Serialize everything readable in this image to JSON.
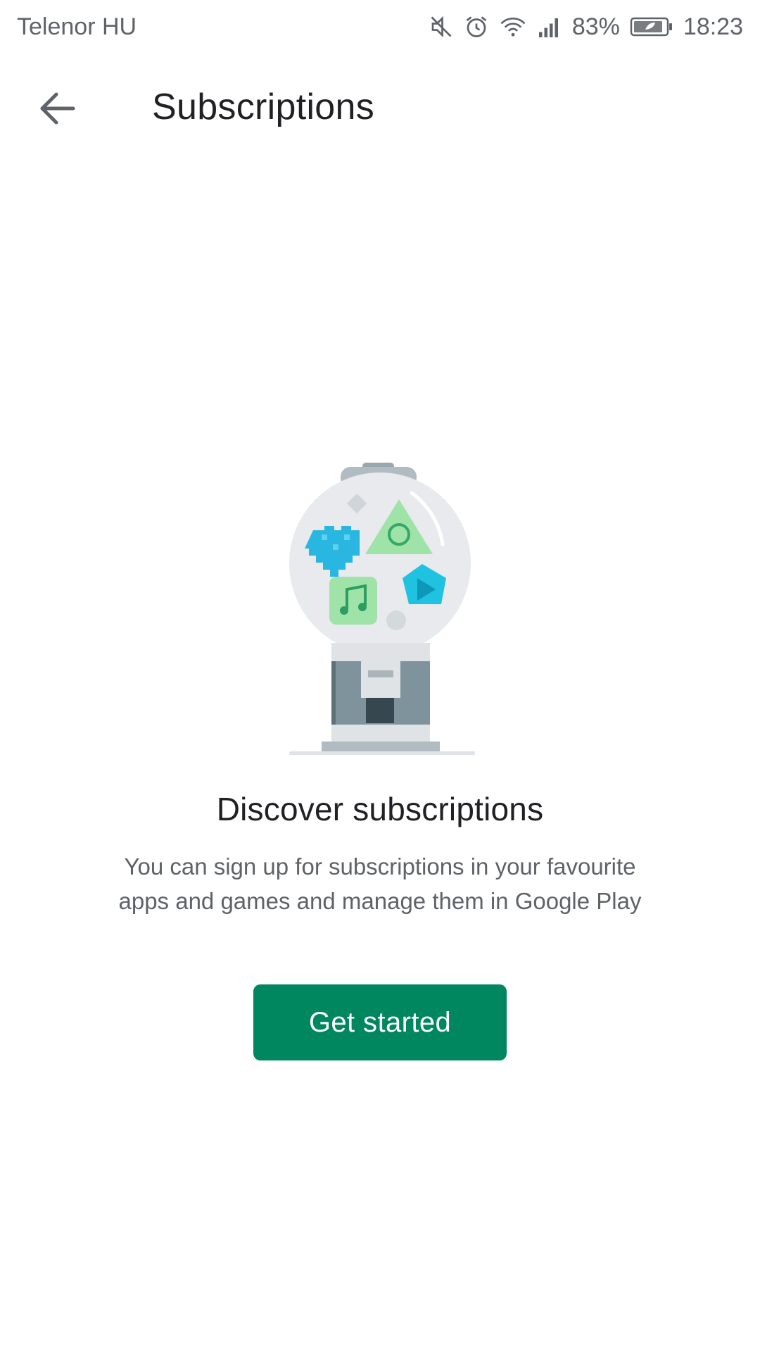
{
  "status_bar": {
    "carrier": "Telenor HU",
    "battery_percent": "83%",
    "time": "18:23",
    "icons": [
      "mute-icon",
      "alarm-icon",
      "wifi-icon",
      "signal-icon",
      "battery-icon"
    ]
  },
  "app_bar": {
    "back_icon": "arrow-back-icon",
    "title": "Subscriptions"
  },
  "empty_state": {
    "illustration": "gumball-machine-illustration",
    "title": "Discover subscriptions",
    "description_line1": "You can sign up for subscriptions in your favourite",
    "description_line2": "apps and games and manage them in Google Play",
    "button_label": "Get started"
  },
  "colors": {
    "accent": "#01875f",
    "text_primary": "#202124",
    "text_secondary": "#5f6368"
  }
}
